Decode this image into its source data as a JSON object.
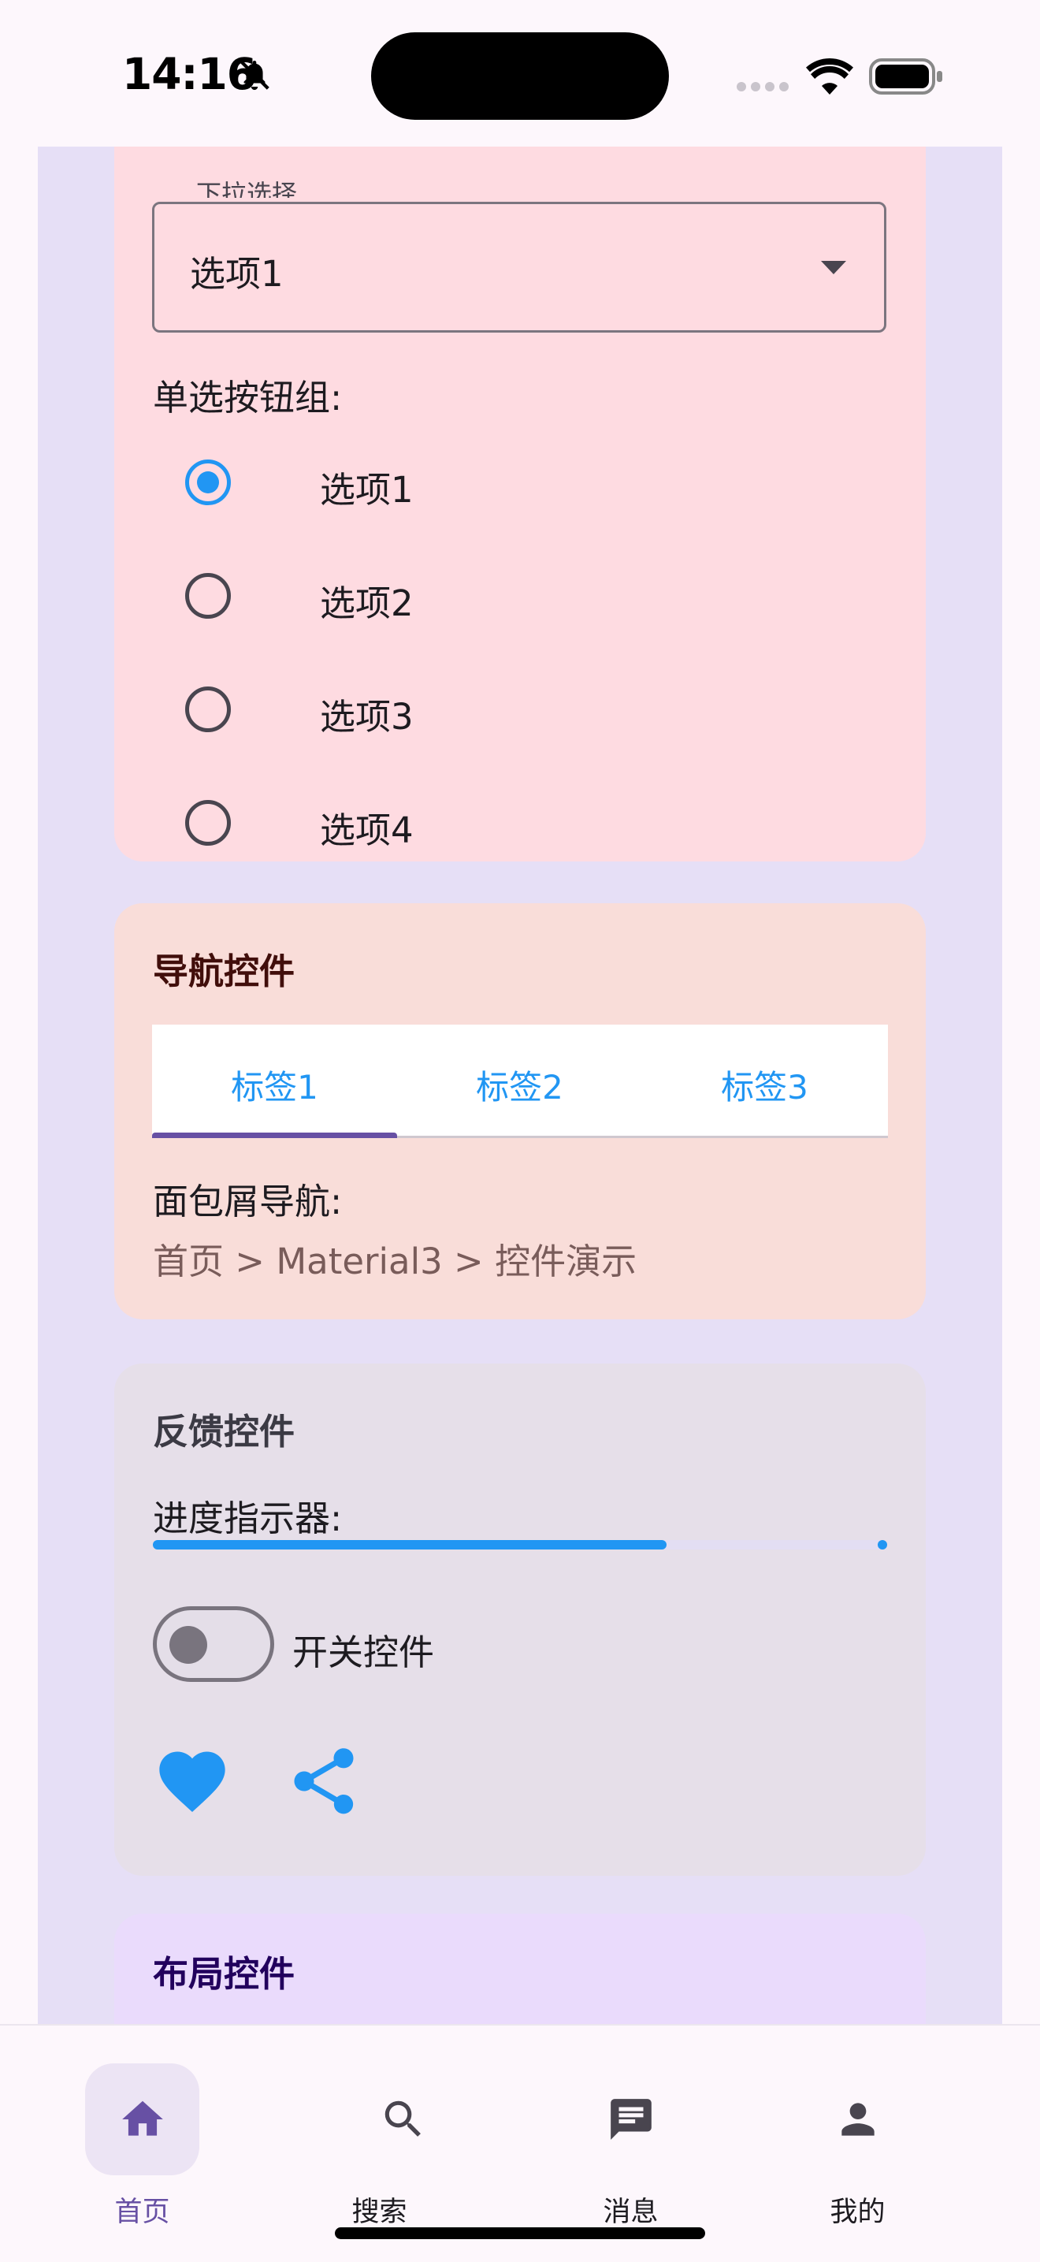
{
  "status_bar": {
    "time": "14:16"
  },
  "select_card": {
    "dropdown_label": "下拉选择",
    "dropdown_value": "选项1",
    "radio_group_label": "单选按钮组:",
    "radio_options": [
      "选项1",
      "选项2",
      "选项3",
      "选项4"
    ],
    "selected_option": "选项1"
  },
  "nav_card": {
    "title": "导航控件",
    "tabs": [
      "标签1",
      "标签2",
      "标签3"
    ],
    "active_tab": "标签1",
    "breadcrumb_label": "面包屑导航:",
    "breadcrumb": "首页 > Material3 > 控件演示"
  },
  "feedback_card": {
    "title": "反馈控件",
    "progress_label": "进度指示器:",
    "progress_value": 0.7,
    "switch_label": "开关控件",
    "switch_on": false
  },
  "layout_card": {
    "title": "布局控件"
  },
  "bottom_nav": {
    "items": [
      {
        "label": "首页",
        "icon": "home-icon",
        "active": true
      },
      {
        "label": "搜索",
        "icon": "search-icon",
        "active": false
      },
      {
        "label": "消息",
        "icon": "message-icon",
        "active": false
      },
      {
        "label": "我的",
        "icon": "person-icon",
        "active": false
      }
    ]
  },
  "colors": {
    "accent": "#2196f3",
    "primary": "#6750a4",
    "select_card_bg": "#fedbe1",
    "nav_card_bg": "#f9ddd9",
    "feedback_card_bg": "#e6dfe9",
    "layout_card_bg": "#eadbfc",
    "page_bg": "#e6dff6"
  }
}
